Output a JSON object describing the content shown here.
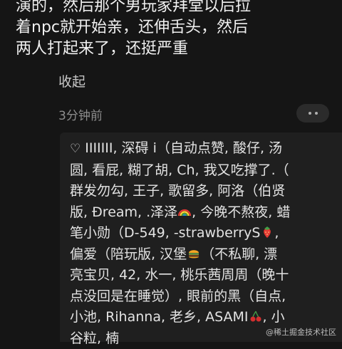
{
  "post": {
    "lines": [
      "演的，然后那个男玩家拜堂以后拉",
      "着npc就开始亲，还伸舌头，然后",
      "两人打起来了，还挺严重"
    ]
  },
  "collapse_label": "收起",
  "timestamp": "3分钟前",
  "likes": {
    "heart_icon": "heart-outline-icon",
    "lines": [
      {
        "pre": "IIIIIII, 深碍 i（自动点赞, 酸仔, 汤"
      },
      {
        "pre": "圆, 看屁, 糊了胡, Ch, 我又吃撑了.（"
      },
      {
        "pre": "群发勿勾, 王子, 歌留多, 阿洛（伯贤"
      },
      {
        "pre": "版, Đream, .泽泽",
        "emoji": "rainbow-icon",
        "post": ", 今晚不熬夜, 蜡"
      },
      {
        "pre": "笔小勋（D-549, -strawberryS",
        "emoji": "strawberry-icon",
        "post": ","
      },
      {
        "pre": "偏爱（陪玩版, 汉堡",
        "emoji": "burger-icon",
        "post": "（不私聊, 漂"
      },
      {
        "pre": "亮宝贝, 42, 水一, 桃乐茜周周（晚十"
      },
      {
        "pre": "点没回是在睡觉）, 眼前的黑（自点,"
      },
      {
        "pre": "小池, Rihanna, 老乡, ASAMI",
        "emoji": "cherry-icon",
        "post": ", 小"
      },
      {
        "pre": "谷粒, 楠"
      }
    ]
  },
  "watermark": "@稀土掘金技术社区",
  "colors": {
    "background": "#151515",
    "panel": "#1f1f1f",
    "text": "#e9e9e9",
    "muted": "#8d8d8d"
  }
}
